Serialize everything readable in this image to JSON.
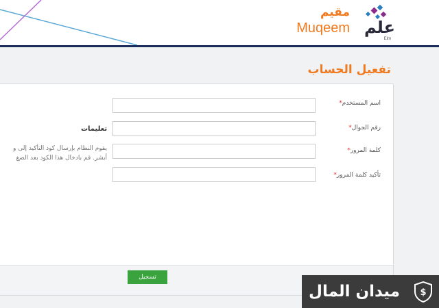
{
  "header": {
    "brand_ar": "مقيم",
    "brand_en": "Muqeem",
    "company_ar": "علم",
    "company_en": "Elm"
  },
  "page": {
    "title": "تفعيل الحساب"
  },
  "form": {
    "username_label": "اسم المستخدم",
    "mobile_label": "رقم الجوال",
    "password_label": "كلمة المرور",
    "confirm_password_label": "تأكيد كلمة المرور",
    "required_mark": "*",
    "username_value": "",
    "mobile_value": "",
    "password_value": "",
    "confirm_password_value": ""
  },
  "instructions": {
    "title": "تعليمات",
    "line1": "يقوم النظام بإرسال كود التأكيد إلى و",
    "line2": "أبشر. قم بادخال هذا الكود بعد الضغ"
  },
  "actions": {
    "register_label": "تسجيل"
  },
  "watermark": {
    "text": "ميدان المال"
  },
  "colors": {
    "accent_orange": "#f07a1f",
    "header_rule": "#1b2c5c",
    "button_green": "#3aa33e",
    "required_red": "#d9332b"
  }
}
